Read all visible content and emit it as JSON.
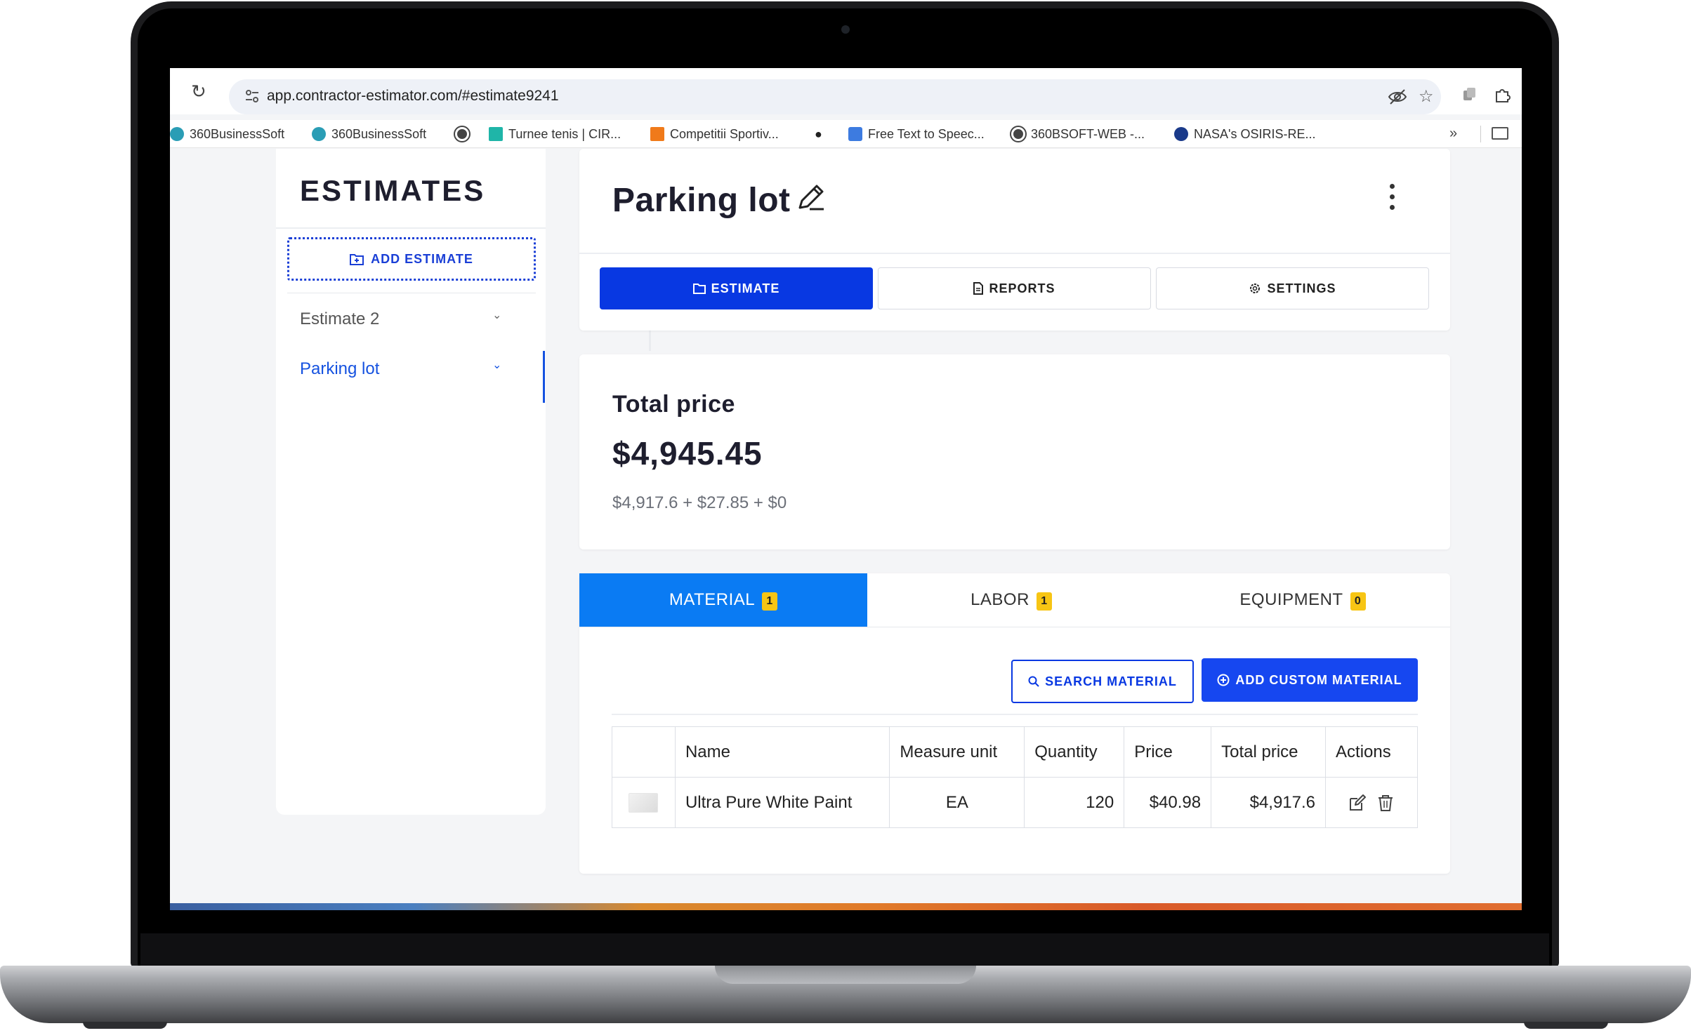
{
  "browser": {
    "url": "app.contractor-estimator.com/#estimate9241",
    "bookmarks": [
      {
        "label": "360BusinessSoft",
        "icon": "360businesssoft-icon",
        "color": "#2a9db5"
      },
      {
        "label": "360BusinessSoft",
        "icon": "360businesssoft-icon",
        "color": "#2a9db5"
      },
      {
        "label": "",
        "icon": "globe-icon",
        "color": "#444444"
      },
      {
        "label": "Turnee tenis | CIR...",
        "icon": "tennis-icon",
        "color": "#1fb5a8"
      },
      {
        "label": "Competitii Sportiv...",
        "icon": "sport-icon",
        "color": "#f07a1a"
      },
      {
        "label": "",
        "icon": "apple-icon",
        "color": "#222222"
      },
      {
        "label": "Free Text to Speec...",
        "icon": "n-logo-icon",
        "color": "#3d7be0"
      },
      {
        "label": "360BSOFT-WEB -...",
        "icon": "globe-icon",
        "color": "#444444"
      },
      {
        "label": "NASA's OSIRIS-RE...",
        "icon": "nasa-icon",
        "color": "#1a3a8a"
      }
    ]
  },
  "sidebar": {
    "title": "ESTIMATES",
    "add_label": "ADD ESTIMATE",
    "items": [
      {
        "label": "Estimate 2",
        "active": false
      },
      {
        "label": "Parking lot",
        "active": true
      }
    ]
  },
  "header": {
    "title": "Parking lot",
    "tabs": [
      {
        "label": "ESTIMATE",
        "icon": "folder-icon",
        "active": true
      },
      {
        "label": "REPORTS",
        "icon": "document-icon",
        "active": false
      },
      {
        "label": "SETTINGS",
        "icon": "gear-icon",
        "active": false
      }
    ]
  },
  "total": {
    "label": "Total price",
    "value": "$4,945.45",
    "breakdown": "$4,917.6 + $27.85 + $0"
  },
  "categories": [
    {
      "label": "MATERIAL",
      "count": "1",
      "active": true
    },
    {
      "label": "LABOR",
      "count": "1",
      "active": false
    },
    {
      "label": "EQUIPMENT",
      "count": "0",
      "active": false
    }
  ],
  "material_actions": {
    "search_label": "SEARCH MATERIAL",
    "add_custom_label": "ADD CUSTOM MATERIAL"
  },
  "table": {
    "headers": [
      "",
      "Name",
      "Measure unit",
      "Quantity",
      "Price",
      "Total price",
      "Actions"
    ],
    "rows": [
      {
        "name": "Ultra Pure White Paint",
        "unit": "EA",
        "quantity": "120",
        "price": "$40.98",
        "total": "$4,917.6"
      }
    ]
  },
  "colors": {
    "primary": "#0838e2",
    "tab_active": "#0a7bf3",
    "badge": "#f7c514",
    "link_active": "#1552e0"
  }
}
